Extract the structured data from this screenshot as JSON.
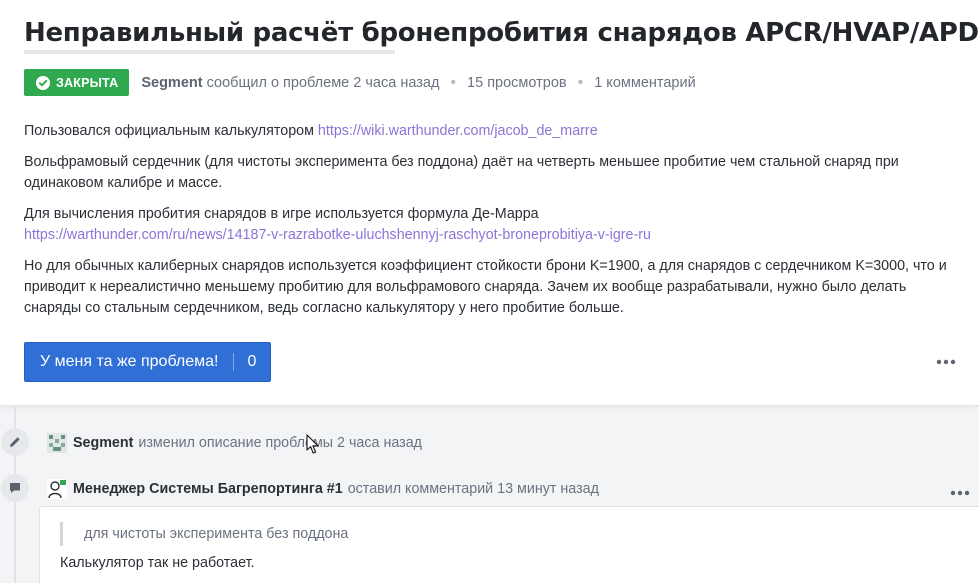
{
  "issue": {
    "title": "Неправильный расчёт бронепробития снарядов APCR/HVAP/APDS",
    "status": "ЗАКРЫТА",
    "status_color": "#2fa84f",
    "author": "Segment",
    "reported_text": "сообщил о проблеме 2 часа назад",
    "views": "15 просмотров",
    "comments_count": "1 комментарий"
  },
  "body": {
    "p1_text": "Пользовался официальным калькулятором ",
    "p1_link": "https://wiki.warthunder.com/jacob_de_marre",
    "p2_text": "Вольфрамовый сердечник (для чистоты эксперимента без поддона) даёт на четверть меньшее пробитие чем стальной снаряд при одинаковом калибре и массе.",
    "p3_text": "Для вычисления пробития снарядов в игре используется формула Де-Марра",
    "p3_link": "https://warthunder.com/ru/news/14187-v-razrabotke-uluchshennyj-raschyot-broneprobitiya-v-igre-ru",
    "p4_text": "Но для обычных калиберных снарядов используется коэффициент стойкости брони K=1900, а для снарядов с сердечником K=3000, что и приводит к нереалистично меньшему пробитию для вольфрамового снаряда. Зачем их вообще разрабатывали, нужно было делать снаряды со стальным сердечником, ведь согласно калькулятору у него пробитие больше."
  },
  "actions": {
    "same_problem_label": "У меня та же проблема!",
    "same_problem_count": "0",
    "accent_color": "#2f6fd6"
  },
  "timeline": {
    "edit_event": {
      "user": "Segment",
      "text": "изменил описание проблемы 2 часа назад"
    },
    "comment_event": {
      "user": "Менеджер Системы Багрепортинга #1",
      "text": "оставил комментарий 13 минут назад",
      "quote": "для чистоты эксперимента без поддона",
      "reply": "Калькулятор так не работает."
    }
  },
  "icons": [
    "check-circle-icon",
    "more-horizontal-icon",
    "pencil-icon",
    "comment-icon",
    "pixel-avatar-icon",
    "manager-avatar-icon",
    "mouse-cursor-icon"
  ]
}
